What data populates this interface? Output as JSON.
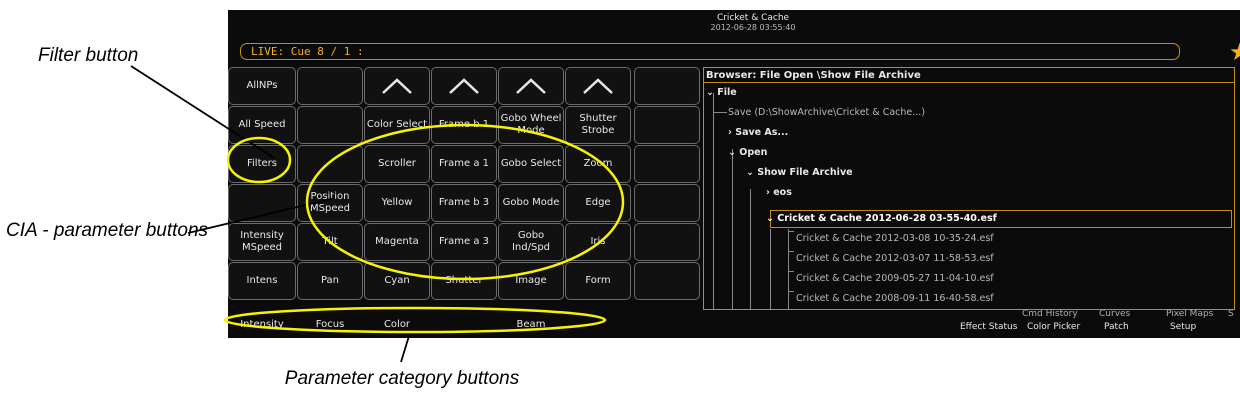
{
  "app": {
    "title": "Cricket & Cache",
    "timestamp": "2012-06-28 03:55:40"
  },
  "cue_bar": {
    "text": "LIVE: Cue  8 / 1 :"
  },
  "star_icon": "star-icon",
  "cia_buttons": {
    "col0": [
      "AllNPs",
      "All Speed",
      "Filters",
      "",
      "Intensity MSpeed",
      "Intens"
    ],
    "col1": [
      "",
      "",
      "",
      "Position MSpeed",
      "Tilt",
      "Pan"
    ],
    "col2": [
      "Color Select",
      "Scroller",
      "Yellow",
      "Magenta",
      "Cyan"
    ],
    "col3": [
      "Frame b 1",
      "Frame a 1",
      "Frame b 3",
      "Frame a 3",
      "Shutter"
    ],
    "col4": [
      "Gobo Wheel Mode",
      "Gobo Select",
      "Gobo Mode",
      "Gobo Ind/Spd",
      "Image"
    ],
    "col5": [
      "Shutter Strobe",
      "Zoom",
      "Edge",
      "Iris",
      "Form"
    ]
  },
  "categories": [
    "Intensity",
    "Focus",
    "Color",
    "Beam"
  ],
  "browser": {
    "title": "Browser: File Open \\Show File Archive",
    "rows": [
      "File",
      "Save (D:\\ShowArchive\\Cricket & Cache...)",
      "Save As...",
      "Open",
      "Show File Archive",
      "eos",
      "Cricket & Cache 2012-06-28 03-55-40.esf",
      "Cricket & Cache 2012-03-08 10-35-24.esf",
      "Cricket & Cache 2012-03-07 11-58-53.esf",
      "Cricket & Cache 2009-05-27 11-04-10.esf",
      "Cricket & Cache 2008-09-11 16-40-58.esf"
    ]
  },
  "tabs": {
    "top": [
      "Cmd History",
      "Curves",
      "Pixel Maps",
      "S"
    ],
    "bottom": [
      "Effect Status",
      "Color Picker",
      "Patch",
      "Setup"
    ]
  },
  "annotations": {
    "filter": "Filter button",
    "cia": "CIA - parameter buttons",
    "category": "Parameter category buttons"
  },
  "colors": {
    "accent": "#f5b01c",
    "highlight": "#f7f400",
    "background": "#0b0b0b"
  }
}
